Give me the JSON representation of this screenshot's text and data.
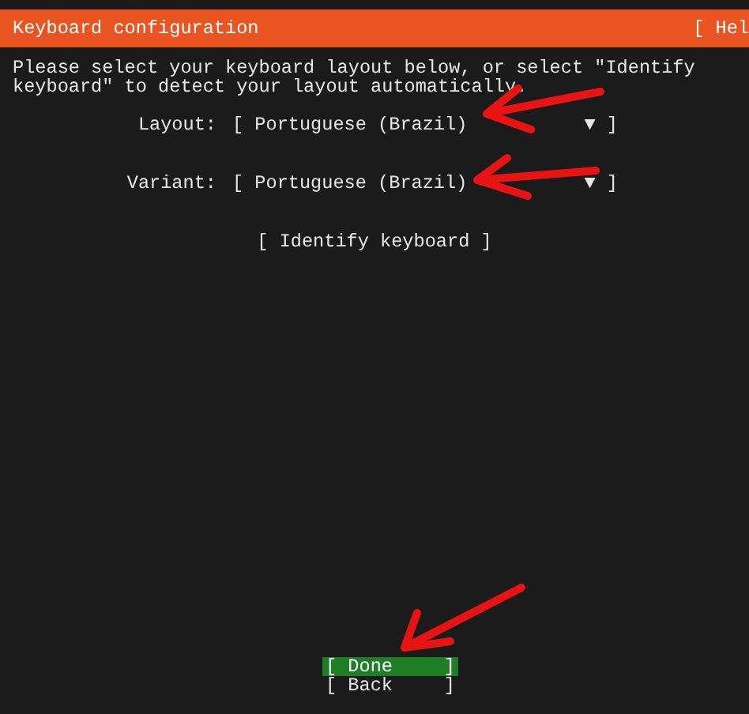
{
  "header": {
    "title": "Keyboard configuration",
    "help": "[ Hel"
  },
  "intro": "Please select your keyboard layout below, or select \"Identify keyboard\" to detect your layout automatically.",
  "fields": [
    {
      "label": "Layout:",
      "value": "[ Portuguese (Brazil)",
      "tail": "▼ ]"
    },
    {
      "label": "Variant:",
      "value": "[ Portuguese (Brazil)",
      "tail": "▼ ]"
    }
  ],
  "identify_button": "[ Identify keyboard ]",
  "buttons": [
    {
      "label": "[ Done",
      "close": "]",
      "selected": true
    },
    {
      "label": "[ Back",
      "close": "]",
      "selected": false
    }
  ]
}
